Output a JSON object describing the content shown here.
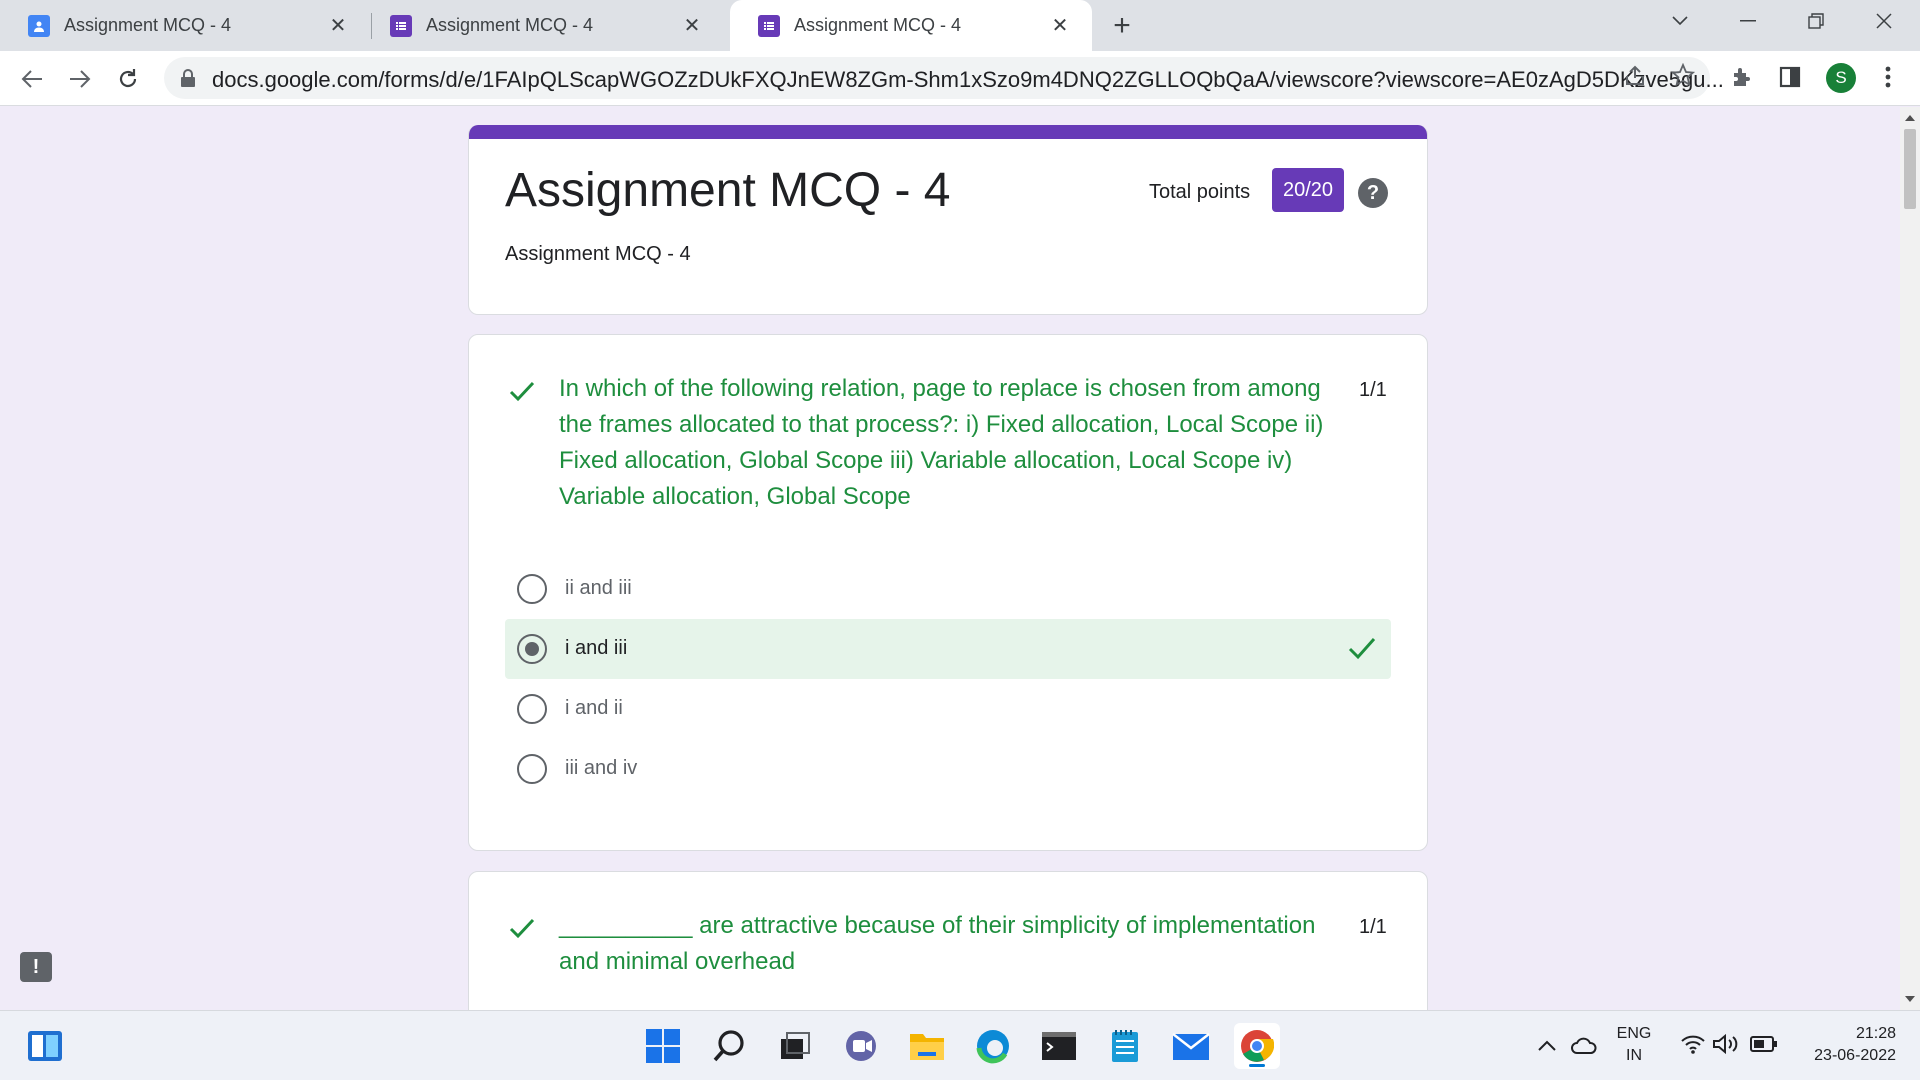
{
  "browser": {
    "tabs": [
      {
        "title": "Assignment MCQ - 4",
        "favicon": "google-classroom-icon",
        "active": false
      },
      {
        "title": "Assignment MCQ - 4",
        "favicon": "google-forms-icon",
        "active": false
      },
      {
        "title": "Assignment MCQ - 4",
        "favicon": "google-forms-icon",
        "active": true
      }
    ],
    "new_tab_symbol": "+",
    "url": "docs.google.com/forms/d/e/1FAIpQLScapWGOZzDUkFXQJnEW8ZGm-Shm1xSzo9m4DNQ2ZGLLOQbQaA/viewscore?viewscore=AE0zAgD5DKzve5gu...",
    "profile_initial": "S"
  },
  "form": {
    "title": "Assignment MCQ - 4",
    "description": "Assignment MCQ - 4",
    "total_points_label": "Total points",
    "total_points_value": "20/20",
    "help_symbol": "?"
  },
  "questions": [
    {
      "text": "In which of the following relation, page to replace is chosen from among the frames allocated to that process?: i) Fixed allocation, Local Scope  ii) Fixed allocation, Global Scope  iii) Variable allocation, Local Scope  iv) Variable allocation, Global Scope",
      "score": "1/1",
      "options": [
        {
          "label": "ii and iii",
          "selected": false,
          "correct": false
        },
        {
          "label": "i and iii",
          "selected": true,
          "correct": true
        },
        {
          "label": "i and ii",
          "selected": false,
          "correct": false
        },
        {
          "label": "iii and iv",
          "selected": false,
          "correct": false
        }
      ]
    },
    {
      "text": "__________ are attractive because of their simplicity of implementation and minimal overhead",
      "score": "1/1"
    }
  ],
  "feedback_symbol": "!",
  "taskbar": {
    "apps": [
      "windows-start-icon",
      "search-icon",
      "task-view-icon",
      "teams-chat-icon",
      "file-explorer-icon",
      "edge-icon",
      "terminal-icon",
      "notepad-icon",
      "mail-icon",
      "chrome-icon"
    ],
    "language_line1": "ENG",
    "language_line2": "IN",
    "time": "21:28",
    "date": "23-06-2022"
  },
  "colors": {
    "form_accent": "#673ab7",
    "correct_green": "#1e8e3e",
    "correct_bg": "#e6f4ea",
    "page_bg": "#f0ebf8"
  }
}
